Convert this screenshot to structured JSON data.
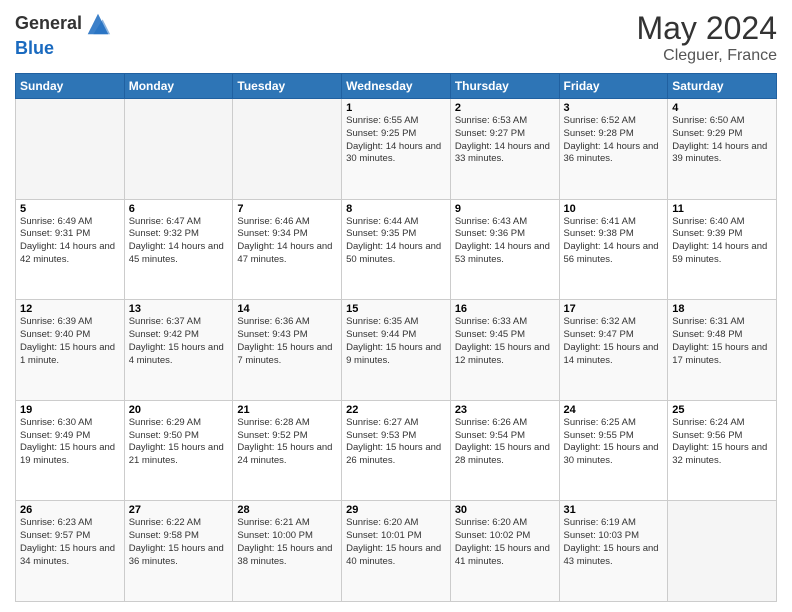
{
  "header": {
    "logo_line1": "General",
    "logo_line2": "Blue",
    "month": "May 2024",
    "location": "Cleguer, France"
  },
  "weekdays": [
    "Sunday",
    "Monday",
    "Tuesday",
    "Wednesday",
    "Thursday",
    "Friday",
    "Saturday"
  ],
  "weeks": [
    [
      {
        "day": "",
        "sunrise": "",
        "sunset": "",
        "daylight": ""
      },
      {
        "day": "",
        "sunrise": "",
        "sunset": "",
        "daylight": ""
      },
      {
        "day": "",
        "sunrise": "",
        "sunset": "",
        "daylight": ""
      },
      {
        "day": "1",
        "sunrise": "Sunrise: 6:55 AM",
        "sunset": "Sunset: 9:25 PM",
        "daylight": "Daylight: 14 hours and 30 minutes."
      },
      {
        "day": "2",
        "sunrise": "Sunrise: 6:53 AM",
        "sunset": "Sunset: 9:27 PM",
        "daylight": "Daylight: 14 hours and 33 minutes."
      },
      {
        "day": "3",
        "sunrise": "Sunrise: 6:52 AM",
        "sunset": "Sunset: 9:28 PM",
        "daylight": "Daylight: 14 hours and 36 minutes."
      },
      {
        "day": "4",
        "sunrise": "Sunrise: 6:50 AM",
        "sunset": "Sunset: 9:29 PM",
        "daylight": "Daylight: 14 hours and 39 minutes."
      }
    ],
    [
      {
        "day": "5",
        "sunrise": "Sunrise: 6:49 AM",
        "sunset": "Sunset: 9:31 PM",
        "daylight": "Daylight: 14 hours and 42 minutes."
      },
      {
        "day": "6",
        "sunrise": "Sunrise: 6:47 AM",
        "sunset": "Sunset: 9:32 PM",
        "daylight": "Daylight: 14 hours and 45 minutes."
      },
      {
        "day": "7",
        "sunrise": "Sunrise: 6:46 AM",
        "sunset": "Sunset: 9:34 PM",
        "daylight": "Daylight: 14 hours and 47 minutes."
      },
      {
        "day": "8",
        "sunrise": "Sunrise: 6:44 AM",
        "sunset": "Sunset: 9:35 PM",
        "daylight": "Daylight: 14 hours and 50 minutes."
      },
      {
        "day": "9",
        "sunrise": "Sunrise: 6:43 AM",
        "sunset": "Sunset: 9:36 PM",
        "daylight": "Daylight: 14 hours and 53 minutes."
      },
      {
        "day": "10",
        "sunrise": "Sunrise: 6:41 AM",
        "sunset": "Sunset: 9:38 PM",
        "daylight": "Daylight: 14 hours and 56 minutes."
      },
      {
        "day": "11",
        "sunrise": "Sunrise: 6:40 AM",
        "sunset": "Sunset: 9:39 PM",
        "daylight": "Daylight: 14 hours and 59 minutes."
      }
    ],
    [
      {
        "day": "12",
        "sunrise": "Sunrise: 6:39 AM",
        "sunset": "Sunset: 9:40 PM",
        "daylight": "Daylight: 15 hours and 1 minute."
      },
      {
        "day": "13",
        "sunrise": "Sunrise: 6:37 AM",
        "sunset": "Sunset: 9:42 PM",
        "daylight": "Daylight: 15 hours and 4 minutes."
      },
      {
        "day": "14",
        "sunrise": "Sunrise: 6:36 AM",
        "sunset": "Sunset: 9:43 PM",
        "daylight": "Daylight: 15 hours and 7 minutes."
      },
      {
        "day": "15",
        "sunrise": "Sunrise: 6:35 AM",
        "sunset": "Sunset: 9:44 PM",
        "daylight": "Daylight: 15 hours and 9 minutes."
      },
      {
        "day": "16",
        "sunrise": "Sunrise: 6:33 AM",
        "sunset": "Sunset: 9:45 PM",
        "daylight": "Daylight: 15 hours and 12 minutes."
      },
      {
        "day": "17",
        "sunrise": "Sunrise: 6:32 AM",
        "sunset": "Sunset: 9:47 PM",
        "daylight": "Daylight: 15 hours and 14 minutes."
      },
      {
        "day": "18",
        "sunrise": "Sunrise: 6:31 AM",
        "sunset": "Sunset: 9:48 PM",
        "daylight": "Daylight: 15 hours and 17 minutes."
      }
    ],
    [
      {
        "day": "19",
        "sunrise": "Sunrise: 6:30 AM",
        "sunset": "Sunset: 9:49 PM",
        "daylight": "Daylight: 15 hours and 19 minutes."
      },
      {
        "day": "20",
        "sunrise": "Sunrise: 6:29 AM",
        "sunset": "Sunset: 9:50 PM",
        "daylight": "Daylight: 15 hours and 21 minutes."
      },
      {
        "day": "21",
        "sunrise": "Sunrise: 6:28 AM",
        "sunset": "Sunset: 9:52 PM",
        "daylight": "Daylight: 15 hours and 24 minutes."
      },
      {
        "day": "22",
        "sunrise": "Sunrise: 6:27 AM",
        "sunset": "Sunset: 9:53 PM",
        "daylight": "Daylight: 15 hours and 26 minutes."
      },
      {
        "day": "23",
        "sunrise": "Sunrise: 6:26 AM",
        "sunset": "Sunset: 9:54 PM",
        "daylight": "Daylight: 15 hours and 28 minutes."
      },
      {
        "day": "24",
        "sunrise": "Sunrise: 6:25 AM",
        "sunset": "Sunset: 9:55 PM",
        "daylight": "Daylight: 15 hours and 30 minutes."
      },
      {
        "day": "25",
        "sunrise": "Sunrise: 6:24 AM",
        "sunset": "Sunset: 9:56 PM",
        "daylight": "Daylight: 15 hours and 32 minutes."
      }
    ],
    [
      {
        "day": "26",
        "sunrise": "Sunrise: 6:23 AM",
        "sunset": "Sunset: 9:57 PM",
        "daylight": "Daylight: 15 hours and 34 minutes."
      },
      {
        "day": "27",
        "sunrise": "Sunrise: 6:22 AM",
        "sunset": "Sunset: 9:58 PM",
        "daylight": "Daylight: 15 hours and 36 minutes."
      },
      {
        "day": "28",
        "sunrise": "Sunrise: 6:21 AM",
        "sunset": "Sunset: 10:00 PM",
        "daylight": "Daylight: 15 hours and 38 minutes."
      },
      {
        "day": "29",
        "sunrise": "Sunrise: 6:20 AM",
        "sunset": "Sunset: 10:01 PM",
        "daylight": "Daylight: 15 hours and 40 minutes."
      },
      {
        "day": "30",
        "sunrise": "Sunrise: 6:20 AM",
        "sunset": "Sunset: 10:02 PM",
        "daylight": "Daylight: 15 hours and 41 minutes."
      },
      {
        "day": "31",
        "sunrise": "Sunrise: 6:19 AM",
        "sunset": "Sunset: 10:03 PM",
        "daylight": "Daylight: 15 hours and 43 minutes."
      },
      {
        "day": "",
        "sunrise": "",
        "sunset": "",
        "daylight": ""
      }
    ]
  ]
}
